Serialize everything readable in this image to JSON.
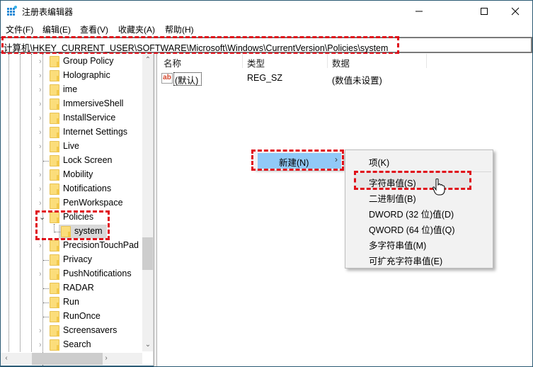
{
  "window": {
    "title": "注册表编辑器",
    "app_icon": "registry-editor-icon",
    "controls": {
      "minimize": "minimize-icon",
      "maximize": "maximize-icon",
      "close": "close-icon"
    }
  },
  "menubar": {
    "items": [
      {
        "label": "文件(F)"
      },
      {
        "label": "编辑(E)"
      },
      {
        "label": "查看(V)"
      },
      {
        "label": "收藏夹(A)"
      },
      {
        "label": "帮助(H)"
      }
    ]
  },
  "address": {
    "value": "计算机\\HKEY_CURRENT_USER\\SOFTWARE\\Microsoft\\Windows\\CurrentVersion\\Policies\\system"
  },
  "tree": {
    "items": [
      {
        "label": "Group Policy",
        "expandable": true
      },
      {
        "label": "Holographic",
        "expandable": true
      },
      {
        "label": "ime",
        "expandable": true
      },
      {
        "label": "ImmersiveShell",
        "expandable": true
      },
      {
        "label": "InstallService",
        "expandable": true
      },
      {
        "label": "Internet Settings",
        "expandable": true
      },
      {
        "label": "Live",
        "expandable": true
      },
      {
        "label": "Lock Screen",
        "expandable": false
      },
      {
        "label": "Mobility",
        "expandable": true
      },
      {
        "label": "Notifications",
        "expandable": true
      },
      {
        "label": "PenWorkspace",
        "expandable": true
      },
      {
        "label": "Policies",
        "expandable": true,
        "expanded": true
      },
      {
        "label": "system",
        "expandable": false,
        "child": true,
        "selected": true
      },
      {
        "label": "PrecisionTouchPad",
        "expandable": true
      },
      {
        "label": "Privacy",
        "expandable": false
      },
      {
        "label": "PushNotifications",
        "expandable": true
      },
      {
        "label": "RADAR",
        "expandable": false
      },
      {
        "label": "Run",
        "expandable": false
      },
      {
        "label": "RunOnce",
        "expandable": false
      },
      {
        "label": "Screensavers",
        "expandable": true
      },
      {
        "label": "Search",
        "expandable": true
      }
    ]
  },
  "list": {
    "columns": [
      {
        "label": "名称"
      },
      {
        "label": "类型"
      },
      {
        "label": "数据"
      }
    ],
    "rows": [
      {
        "name": "(默认)",
        "type": "REG_SZ",
        "data": "(数值未设置)",
        "icon": "string-value-icon"
      }
    ]
  },
  "context_menu": {
    "new_label": "新建(N)",
    "submenu": [
      {
        "label": "项(K)"
      },
      {
        "label": "字符串值(S)"
      },
      {
        "label": "二进制值(B)"
      },
      {
        "label": "DWORD (32 位)值(D)"
      },
      {
        "label": "QWORD (64 位)值(Q)"
      },
      {
        "label": "多字符串值(M)"
      },
      {
        "label": "可扩充字符串值(E)"
      }
    ]
  },
  "annotations": {
    "highlight_color": "#e0101a"
  }
}
